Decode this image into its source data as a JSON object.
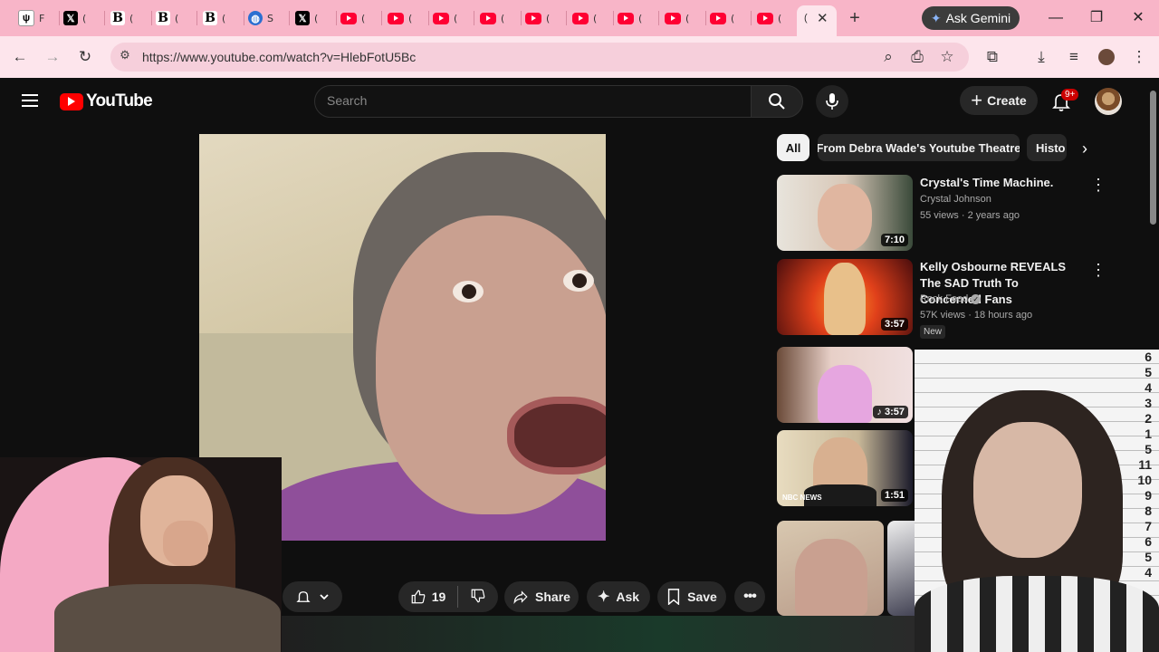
{
  "browser": {
    "tabs": [
      {
        "icon": "wolf-icon",
        "title": "F"
      },
      {
        "icon": "x-icon",
        "title": "("
      },
      {
        "icon": "b-icon",
        "title": "("
      },
      {
        "icon": "b-icon",
        "title": "("
      },
      {
        "icon": "b-icon",
        "title": "("
      },
      {
        "icon": "globe-icon",
        "title": "S"
      },
      {
        "icon": "x-icon",
        "title": "("
      },
      {
        "icon": "youtube-icon",
        "title": "("
      },
      {
        "icon": "youtube-icon",
        "title": "("
      },
      {
        "icon": "youtube-icon",
        "title": "("
      },
      {
        "icon": "youtube-icon",
        "title": "("
      },
      {
        "icon": "youtube-icon",
        "title": "("
      },
      {
        "icon": "youtube-icon",
        "title": "("
      },
      {
        "icon": "youtube-icon",
        "title": "("
      },
      {
        "icon": "youtube-icon",
        "title": "("
      },
      {
        "icon": "youtube-icon",
        "title": "("
      },
      {
        "icon": "youtube-icon",
        "title": "("
      }
    ],
    "active_tab_title": "(",
    "new_tab": "+",
    "gemini_label": "Ask Gemini",
    "url": "https://www.youtube.com/watch?v=HlebFotU5Bc",
    "tab_strip_color": "#f8b5c8",
    "toolbar_color": "#fde5ec"
  },
  "youtube": {
    "logo_text": "YouTube",
    "search_placeholder": "Search",
    "create_label": "Create",
    "notifications": "9+",
    "actions": {
      "likes": "19",
      "share": "Share",
      "ask": "Ask",
      "save": "Save"
    },
    "chips": [
      "All",
      "From Debra Wade's Youtube Theatre",
      "Histo"
    ],
    "recommendations": [
      {
        "title": "Crystal's Time Machine.",
        "channel": "Crystal Johnson",
        "meta": "55 views · 2 years ago",
        "duration": "7:10"
      },
      {
        "title": "Kelly Osbourne REVEALS The SAD Truth To Concerned Fans",
        "channel": "Rock Feed",
        "meta": "57K views · 18 hours ago",
        "badge": "New",
        "duration": "3:57"
      },
      {
        "title": "",
        "channel": "",
        "meta": "",
        "duration": "3:57"
      },
      {
        "title": "",
        "channel": "",
        "meta": "",
        "duration": "1:51",
        "watermark": "NBC NEWS"
      }
    ],
    "mugshot_numbers": [
      "6",
      "5",
      "4",
      "3",
      "2",
      "1",
      "5",
      "11",
      "10",
      "9",
      "8",
      "7",
      "6",
      "5",
      "4"
    ]
  }
}
